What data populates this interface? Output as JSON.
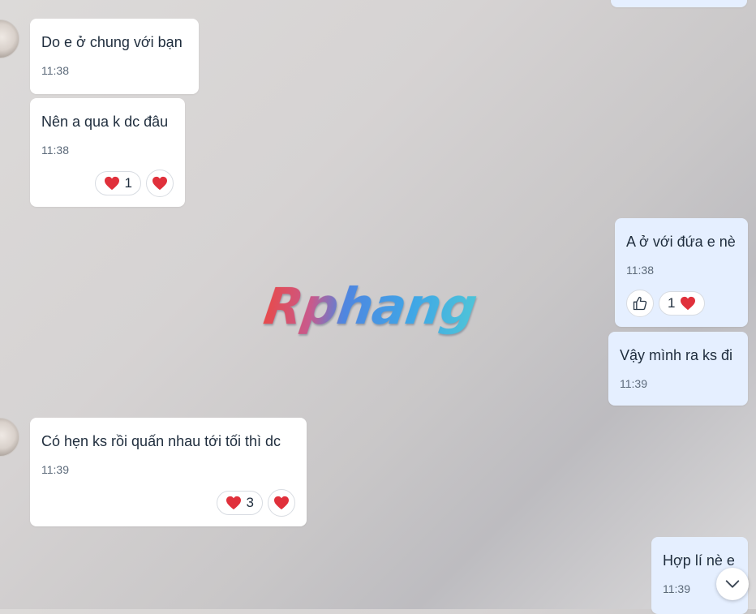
{
  "watermark": "Rphang",
  "messages": [
    {
      "text": "Do e ở chung với bạn",
      "time": "11:38"
    },
    {
      "text": "Nên a qua k dc đâu",
      "time": "11:38",
      "reactions": [
        {
          "icon": "heart-icon",
          "count": "1"
        }
      ]
    },
    {
      "text": "A ở với đứa e nè",
      "time": "11:38",
      "reactions": [
        {
          "icon": "heart-icon",
          "count": "1"
        }
      ]
    },
    {
      "text": "Vậy mình ra ks đi",
      "time": "11:39"
    },
    {
      "text": "Có hẹn ks rồi quấn nhau tới tối thì dc",
      "time": "11:39",
      "reactions": [
        {
          "icon": "heart-icon",
          "count": "3"
        }
      ]
    },
    {
      "text": "Hợp lí nè e",
      "time": "11:39"
    }
  ],
  "colors": {
    "incoming_bubble": "#ffffff",
    "outgoing_bubble": "#e5efff",
    "heart": "#e0303b",
    "text": "#1f2d3d",
    "time": "#5c6a7a"
  },
  "icons": {
    "heart": "heart-icon",
    "like": "thumbs-up-icon",
    "scroll_down": "chevron-down-icon"
  }
}
